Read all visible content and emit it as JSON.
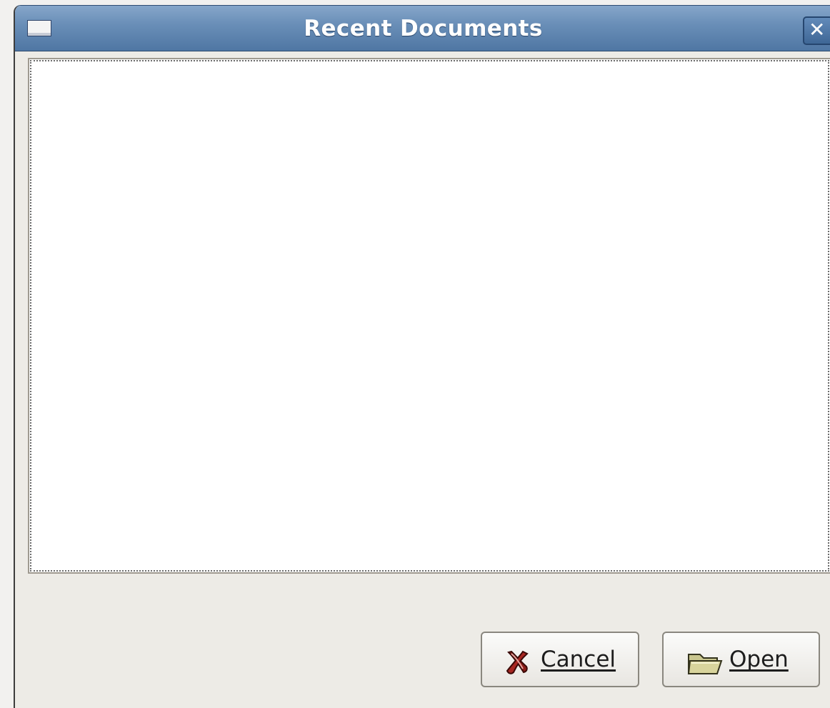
{
  "window": {
    "title": "Recent Documents",
    "close_label": "✕"
  },
  "buttons": {
    "cancel_label": "Cancel",
    "open_label": "Open"
  },
  "icons": {
    "window_menu": "window-menu-icon",
    "cancel": "cancel-icon",
    "open": "folder-icon"
  },
  "colors": {
    "titlebar": "#5f86b3",
    "window_background": "#edebe6",
    "list_background": "#ffffff"
  }
}
